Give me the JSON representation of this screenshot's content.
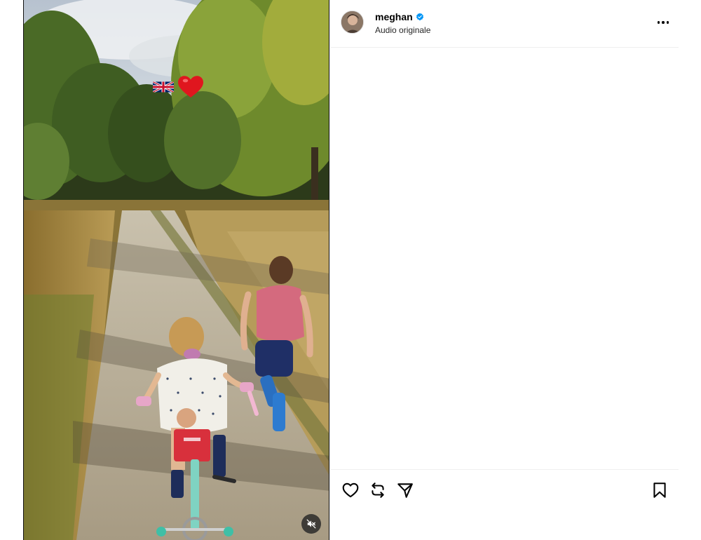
{
  "post": {
    "username": "meghan",
    "verified": true,
    "audio_label": "Audio originale"
  },
  "media": {
    "sticker_icons": [
      "uk-flag-icon",
      "red-heart-icon"
    ],
    "muted": true
  },
  "actions": {
    "like_icon": "heart-outline-icon",
    "repost_icon": "repost-icon",
    "share_icon": "paper-plane-icon",
    "save_icon": "bookmark-icon",
    "more_icon": "more-horizontal-icon"
  },
  "colors": {
    "verified_badge": "#0095f6",
    "border": "#efefef",
    "text_primary": "#000000"
  }
}
